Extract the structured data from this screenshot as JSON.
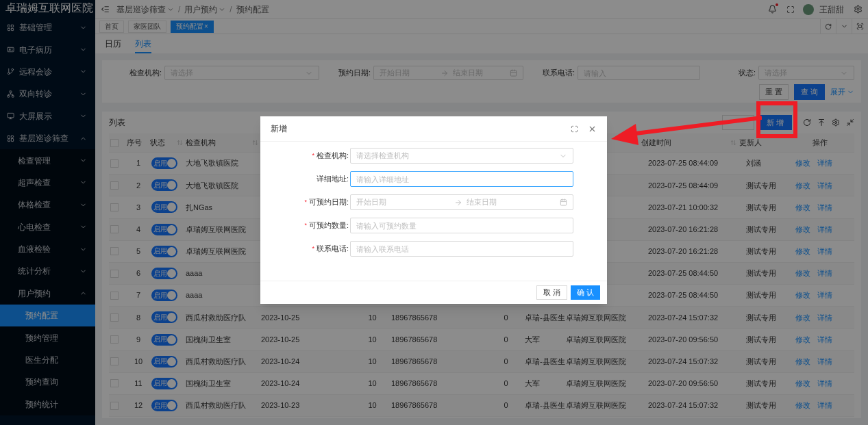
{
  "app_title": "卓瑞姆互联网医院",
  "sidebar": {
    "items": [
      {
        "label": "基础管理",
        "expanded": false
      },
      {
        "label": "电子病历",
        "expanded": false
      },
      {
        "label": "远程会诊",
        "expanded": false
      },
      {
        "label": "双向转诊",
        "expanded": false
      },
      {
        "label": "大屏展示",
        "expanded": false
      },
      {
        "label": "基层巡诊筛查",
        "expanded": true,
        "children": [
          {
            "label": "检查管理",
            "expanded": false
          },
          {
            "label": "超声检查",
            "expanded": false
          },
          {
            "label": "体格检查",
            "expanded": false
          },
          {
            "label": "心电检查",
            "expanded": false
          },
          {
            "label": "血液检验",
            "expanded": false
          },
          {
            "label": "统计分析",
            "expanded": false
          },
          {
            "label": "用户预约",
            "expanded": true,
            "children": [
              {
                "label": "预约配置",
                "selected": true
              },
              {
                "label": "预约管理",
                "selected": false
              },
              {
                "label": "医生分配",
                "selected": false
              },
              {
                "label": "预约查询",
                "selected": false
              },
              {
                "label": "预约统计",
                "selected": false
              }
            ]
          }
        ]
      }
    ]
  },
  "breadcrumb": [
    {
      "label": "基层巡诊筛查",
      "dropdown": true
    },
    {
      "separator": "/",
      "label": "用户预约",
      "dropdown": true
    },
    {
      "separator": "/",
      "label": "预约配置",
      "dropdown": false
    }
  ],
  "user": {
    "name": "王甜甜",
    "has_notification": true
  },
  "page_tabs": [
    {
      "label": "首页",
      "selected": false,
      "closable": false
    },
    {
      "label": "家医团队",
      "selected": false,
      "closable": false
    },
    {
      "label": "预约配置",
      "selected": true,
      "closable": true,
      "close": "×"
    }
  ],
  "view_tabs": [
    {
      "label": "日历",
      "selected": false
    },
    {
      "label": "列表",
      "selected": true
    }
  ],
  "filters": [
    {
      "kind": "select",
      "label": "检查机构:",
      "placeholder": "请选择"
    },
    {
      "kind": "daterange",
      "label": "预约日期:",
      "placeholder": "开始日期",
      "placeholder_end": "结束日期"
    },
    {
      "kind": "input",
      "label": "联系电话:",
      "placeholder": "请输入"
    },
    {
      "kind": "select",
      "label": "状态:",
      "placeholder": "请选择"
    }
  ],
  "filter_actions": {
    "reset": "重 置",
    "search": "查 询",
    "expand": "展开"
  },
  "table": {
    "title": "列表",
    "new_button": "新 增",
    "all_checked": false,
    "columns": [
      {
        "label": "序号",
        "sortable": false
      },
      {
        "label": "状态",
        "sortable": true
      },
      {
        "label": "检查机构",
        "sortable": true
      },
      {
        "label": "创建时间",
        "sortable": true
      },
      {
        "label": "更新人",
        "sortable": false
      },
      {
        "label": "操作",
        "sortable": false
      }
    ],
    "rows": [
      {
        "index": "1",
        "checked": false,
        "status": "启用",
        "on": true,
        "org": "大地飞歌镇医院",
        "created": "2023-07-25 08:44:09",
        "updater": "刘涵",
        "actions": [
          "修改",
          "详情"
        ]
      },
      {
        "index": "2",
        "checked": false,
        "status": "启用",
        "on": true,
        "org": "大地飞歌镇医院",
        "created": "2023-07-25 08:44:09",
        "updater": "测试专用",
        "actions": [
          "修改",
          "详情"
        ]
      },
      {
        "index": "3",
        "checked": false,
        "status": "启用",
        "on": true,
        "org": "扎NGas",
        "created": "2023-07-21 10:00:32",
        "updater": "测试专用",
        "actions": [
          "修改",
          "详情"
        ]
      },
      {
        "index": "4",
        "checked": false,
        "status": "启用",
        "on": true,
        "org": "卓瑞姆互联网医院",
        "created": "2023-07-20 16:21:28",
        "updater": "测试专用",
        "actions": [
          "修改",
          "详情"
        ]
      },
      {
        "index": "5",
        "checked": false,
        "status": "启用",
        "on": true,
        "org": "卓瑞姆互联网医院",
        "created": "2023-07-20 16:21:28",
        "updater": "测试专用",
        "actions": [
          "修改",
          "详情"
        ]
      },
      {
        "index": "6",
        "checked": false,
        "status": "启用",
        "on": true,
        "org": "aaaa",
        "created": "2023-07-25 08:44:50",
        "updater": "测试专用",
        "actions": [
          "修改",
          "详情"
        ]
      },
      {
        "index": "7",
        "checked": false,
        "status": "启用",
        "on": true,
        "org": "aaaa",
        "created": "2023-07-25 08:44:50",
        "updater": "测试专用",
        "actions": [
          "修改",
          "详情"
        ]
      },
      {
        "index": "8",
        "checked": false,
        "status": "启用",
        "on": true,
        "org": "西瓜村救助医疗队",
        "date": "2023-10-25",
        "count": "10",
        "phone": "18967865678",
        "booked": "0",
        "doctor": "卓瑞-县医生",
        "hospital": "卓瑞姆互联网医院",
        "created": "2023-07-24 15:07:32",
        "updater": "测试专用",
        "actions": [
          "修改",
          "详情"
        ]
      },
      {
        "index": "9",
        "checked": false,
        "status": "启用",
        "on": true,
        "org": "国槐街卫生室",
        "date": "2023-10-25",
        "count": "10",
        "phone": "18967865678",
        "booked": "0",
        "doctor": "大军",
        "hospital": "卓瑞姆互联网医院",
        "created": "2023-07-20 09:56:50",
        "updater": "测试专用",
        "actions": [
          "修改",
          "详情"
        ]
      },
      {
        "index": "10",
        "checked": false,
        "status": "启用",
        "on": true,
        "org": "西瓜村救助医疗队",
        "date": "2023-10-24",
        "count": "10",
        "phone": "18967865678",
        "booked": "0",
        "doctor": "卓瑞-县医生",
        "hospital": "卓瑞姆互联网医院",
        "created": "2023-07-24 15:07:32",
        "updater": "测试专用",
        "actions": [
          "修改",
          "详情"
        ]
      },
      {
        "index": "11",
        "checked": false,
        "status": "启用",
        "on": true,
        "org": "国槐街卫生室",
        "date": "2023-10-24",
        "count": "10",
        "phone": "18967865678",
        "booked": "0",
        "doctor": "大军",
        "hospital": "卓瑞姆互联网医院",
        "created": "2023-07-20 09:56:50",
        "updater": "测试专用",
        "actions": [
          "修改",
          "详情"
        ]
      },
      {
        "index": "12",
        "checked": false,
        "status": "启用",
        "on": true,
        "org": "西瓜村救助医疗队",
        "date": "2023-10-23",
        "count": "10",
        "phone": "18967865678",
        "booked": "0",
        "doctor": "卓瑞-县医生",
        "hospital": "卓瑞姆互联网医院",
        "created": "2023-07-24 15:07:32",
        "updater": "测试专用",
        "actions": [
          "修改",
          "详情"
        ]
      }
    ]
  },
  "modal": {
    "title": "新增",
    "required_mark": "*",
    "fields": [
      {
        "kind": "select",
        "label": "检查机构:",
        "required": true,
        "placeholder": "请选择检查机构",
        "focused": false
      },
      {
        "kind": "input",
        "label": "详细地址:",
        "required": false,
        "placeholder": "请输入详细地址",
        "focused": true
      },
      {
        "kind": "daterange",
        "label": "可预约日期:",
        "required": true,
        "placeholder": "开始日期",
        "placeholder_end": "结束日期",
        "focused": false
      },
      {
        "kind": "input",
        "label": "可预约数量:",
        "required": true,
        "placeholder": "请输入可预约数量",
        "focused": false
      },
      {
        "kind": "input",
        "label": "联系电话:",
        "required": true,
        "placeholder": "请输入联系电话",
        "focused": false
      }
    ],
    "cancel": "取 消",
    "confirm": "确 认"
  }
}
